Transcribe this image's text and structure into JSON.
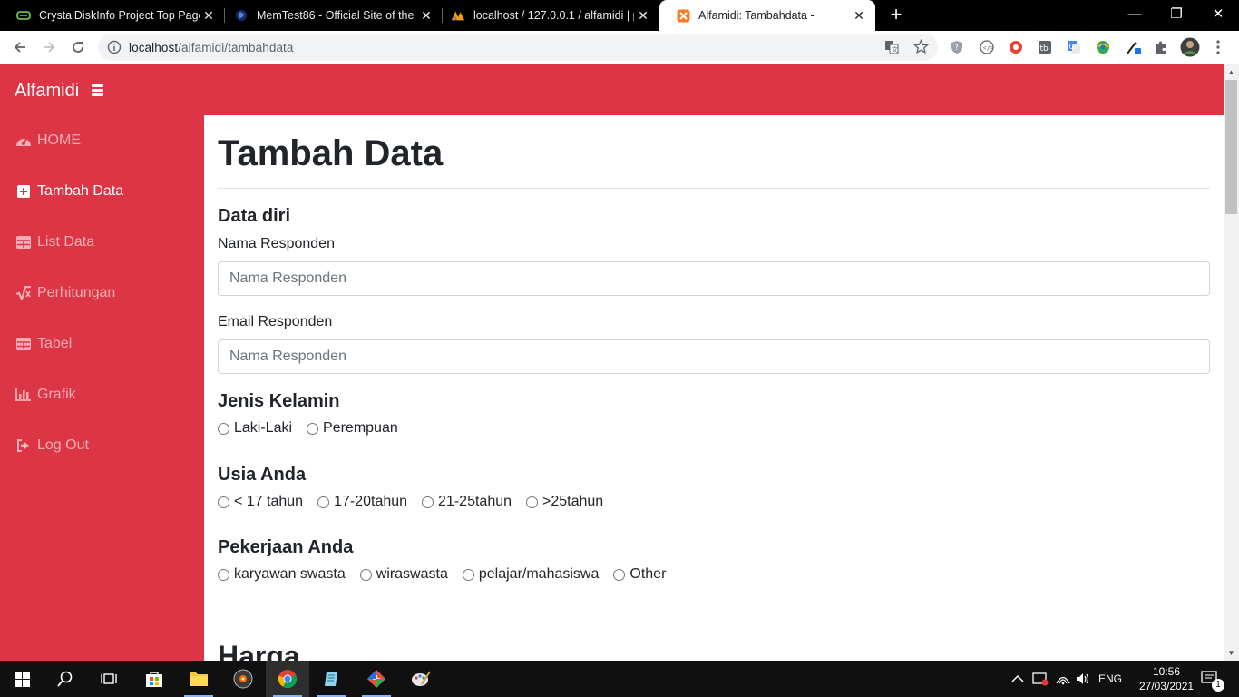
{
  "browser": {
    "tabs": [
      {
        "title": "CrystalDiskInfo Project Top Page",
        "icon": "crystaldiskinfo-icon"
      },
      {
        "title": "MemTest86 - Official Site of the x",
        "icon": "memtest-icon"
      },
      {
        "title": "localhost / 127.0.0.1 / alfamidi | p",
        "icon": "phpmyadmin-icon"
      },
      {
        "title": "Alfamidi: Tambahdata -",
        "icon": "xampp-icon"
      }
    ],
    "address": {
      "host": "localhost",
      "path": "/alfamidi/tambahdata"
    }
  },
  "app": {
    "brand": "Alfamidi",
    "accent": "#dc3545",
    "sidebar": [
      {
        "label": "HOME",
        "icon": "dashboard-icon"
      },
      {
        "label": "Tambah Data",
        "icon": "plus-square-icon"
      },
      {
        "label": "List Data",
        "icon": "table-icon"
      },
      {
        "label": "Perhitungan",
        "icon": "square-root-icon"
      },
      {
        "label": "Tabel",
        "icon": "table-icon"
      },
      {
        "label": "Grafik",
        "icon": "bar-chart-icon"
      },
      {
        "label": "Log Out",
        "icon": "sign-out-icon"
      }
    ]
  },
  "form": {
    "page_title": "Tambah Data",
    "section_data_diri": "Data diri",
    "nama_label": "Nama Responden",
    "nama_placeholder": "Nama Responden",
    "email_label": "Email Responden",
    "email_placeholder": "Nama Responden",
    "gender": {
      "title": "Jenis Kelamin",
      "options": [
        "Laki-Laki",
        "Perempuan"
      ]
    },
    "usia": {
      "title": "Usia Anda",
      "options": [
        "< 17 tahun",
        "17-20tahun",
        "21-25tahun",
        ">25tahun"
      ]
    },
    "pekerjaan": {
      "title": "Pekerjaan Anda",
      "options": [
        "karyawan swasta",
        "wiraswasta",
        "pelajar/mahasiswa",
        "Other"
      ]
    },
    "next_section": "Harga"
  },
  "taskbar": {
    "language": "ENG",
    "time": "10:56",
    "date": "27/03/2021",
    "notifications": "1"
  }
}
